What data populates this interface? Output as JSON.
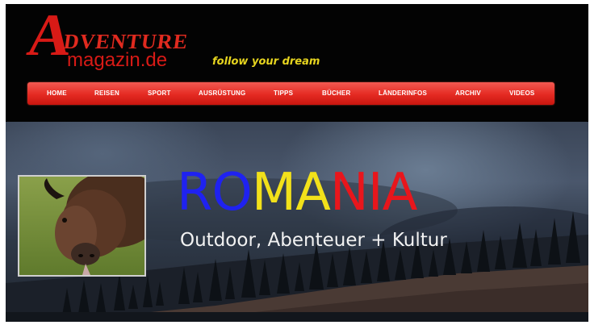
{
  "header": {
    "logo_initial": "A",
    "logo_word": "DVENTURE",
    "logo_domain": "magazin.de",
    "tagline": "follow your dream"
  },
  "nav": {
    "items": [
      "HOME",
      "REISEN",
      "SPORT",
      "AUSRÜSTUNG",
      "TIPPS",
      "BÜCHER",
      "LÄNDERINFOS",
      "ARCHIV",
      "VIDEOS"
    ]
  },
  "hero": {
    "title_parts": [
      {
        "text": "RO",
        "color": "#1f22f0"
      },
      {
        "text": "MA",
        "color": "#f2e11a"
      },
      {
        "text": "NIA",
        "color": "#e8161c"
      }
    ],
    "subtitle": "Outdoor, Abenteuer + Kultur",
    "photo_subject": "bison-photo"
  },
  "colors": {
    "brand_red": "#d81a16",
    "nav_red": "#e42a22",
    "tagline_yellow": "#e7d51f"
  }
}
